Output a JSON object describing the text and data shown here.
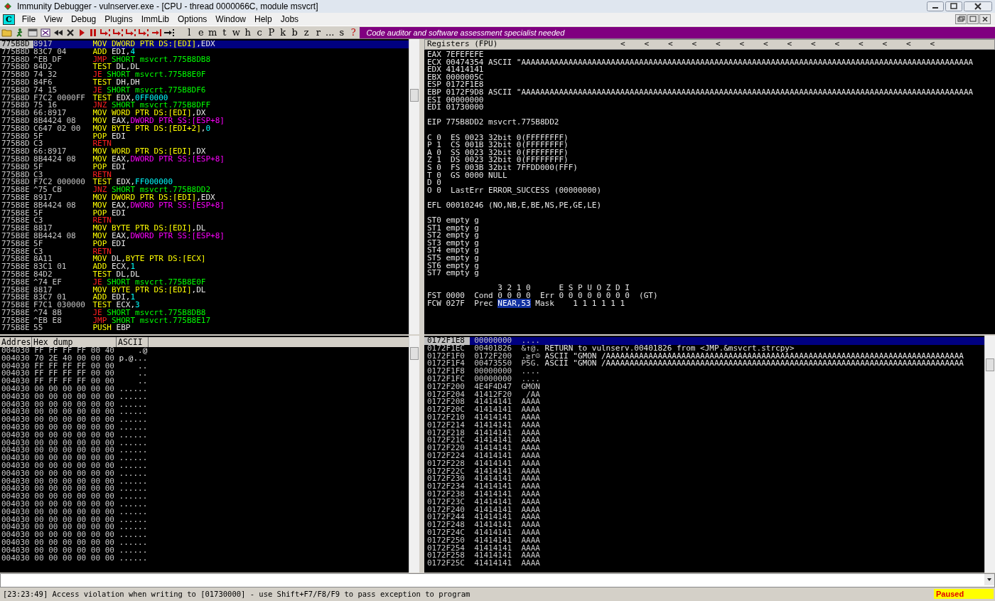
{
  "window": {
    "title": "Immunity Debugger - vulnserver.exe - [CPU - thread 0000066C, module msvcrt]"
  },
  "menu": {
    "logo": "C",
    "items": [
      "File",
      "View",
      "Debug",
      "Plugins",
      "ImmLib",
      "Options",
      "Window",
      "Help",
      "Jobs"
    ]
  },
  "toolbar": {
    "letters": [
      {
        "label": "l",
        "kind": "letter"
      },
      {
        "label": "e",
        "kind": "letter"
      },
      {
        "label": "m",
        "kind": "letter"
      },
      {
        "label": "t",
        "kind": "letter"
      },
      {
        "label": "w",
        "kind": "letter"
      },
      {
        "label": "h",
        "kind": "letter"
      },
      {
        "label": "c",
        "kind": "letter"
      },
      {
        "label": "P",
        "kind": "letter"
      },
      {
        "label": "k",
        "kind": "letter"
      },
      {
        "label": "b",
        "kind": "letter"
      },
      {
        "label": "z",
        "kind": "letter"
      },
      {
        "label": "r",
        "kind": "letter"
      },
      {
        "label": "...",
        "kind": "letter"
      },
      {
        "label": "s",
        "kind": "letter"
      },
      {
        "label": "?",
        "kind": "help"
      }
    ],
    "banner": "Code auditor and software assessment specialist needed"
  },
  "disassembly": [
    {
      "address": "775B8D",
      "bytes": "8917",
      "selected": true,
      "parts": [
        {
          "text": "MOV DWORD PTR DS:[EDI]",
          "kind": "op"
        },
        {
          "text": ",EDX",
          "kind": "reg"
        }
      ]
    },
    {
      "address": "775B8D",
      "bytes": "83C7 04",
      "selected": false,
      "parts": [
        {
          "text": "ADD",
          "kind": "op"
        },
        {
          "text": " EDI,",
          "kind": "reg"
        },
        {
          "text": "4",
          "kind": "imm"
        }
      ]
    },
    {
      "address": "775B8D",
      "bytes": "^EB DF",
      "selected": false,
      "parts": [
        {
          "text": "JMP",
          "kind": "jmp"
        },
        {
          "text": " SHORT msvcrt.775B8DB8",
          "kind": "target"
        }
      ]
    },
    {
      "address": "775B8D",
      "bytes": "84D2",
      "selected": false,
      "parts": [
        {
          "text": "TEST",
          "kind": "op"
        },
        {
          "text": " DL,DL",
          "kind": "reg"
        }
      ]
    },
    {
      "address": "775B8D",
      "bytes": "74 32",
      "selected": false,
      "parts": [
        {
          "text": "JE",
          "kind": "jmp"
        },
        {
          "text": " SHORT msvcrt.775B8E0F",
          "kind": "target"
        }
      ]
    },
    {
      "address": "775B8D",
      "bytes": "84F6",
      "selected": false,
      "parts": [
        {
          "text": "TEST",
          "kind": "op"
        },
        {
          "text": " DH,DH",
          "kind": "reg"
        }
      ]
    },
    {
      "address": "775B8D",
      "bytes": "74 15",
      "selected": false,
      "parts": [
        {
          "text": "JE",
          "kind": "jmp"
        },
        {
          "text": " SHORT msvcrt.775B8DF6",
          "kind": "target"
        }
      ]
    },
    {
      "address": "775B8D",
      "bytes": "F7C2 0000FF",
      "selected": false,
      "parts": [
        {
          "text": "TEST",
          "kind": "op"
        },
        {
          "text": " EDX,",
          "kind": "reg"
        },
        {
          "text": "0FF0000",
          "kind": "imm"
        }
      ]
    },
    {
      "address": "775B8D",
      "bytes": "75 16",
      "selected": false,
      "parts": [
        {
          "text": "JNZ",
          "kind": "jmp"
        },
        {
          "text": " SHORT msvcrt.775B8DFF",
          "kind": "target"
        }
      ]
    },
    {
      "address": "775B8D",
      "bytes": "66:8917",
      "selected": false,
      "parts": [
        {
          "text": "MOV WORD PTR DS:[EDI]",
          "kind": "op"
        },
        {
          "text": ",DX",
          "kind": "reg"
        }
      ]
    },
    {
      "address": "775B8D",
      "bytes": "8B4424 08",
      "selected": false,
      "parts": [
        {
          "text": "MOV",
          "kind": "op"
        },
        {
          "text": " EAX,",
          "kind": "reg"
        },
        {
          "text": "DWORD PTR SS:[ESP+8]",
          "kind": "stack"
        }
      ]
    },
    {
      "address": "775B8D",
      "bytes": "C647 02 00",
      "selected": false,
      "parts": [
        {
          "text": "MOV BYTE PTR DS:[EDI+2]",
          "kind": "op"
        },
        {
          "text": ",",
          "kind": "reg"
        },
        {
          "text": "0",
          "kind": "imm"
        }
      ]
    },
    {
      "address": "775B8D",
      "bytes": "5F",
      "selected": false,
      "parts": [
        {
          "text": "POP",
          "kind": "op"
        },
        {
          "text": " EDI",
          "kind": "reg"
        }
      ]
    },
    {
      "address": "775B8D",
      "bytes": "C3",
      "selected": false,
      "parts": [
        {
          "text": "RETN",
          "kind": "jmp"
        }
      ]
    },
    {
      "address": "775B8D",
      "bytes": "66:8917",
      "selected": false,
      "parts": [
        {
          "text": "MOV WORD PTR DS:[EDI]",
          "kind": "op"
        },
        {
          "text": ",DX",
          "kind": "reg"
        }
      ]
    },
    {
      "address": "775B8D",
      "bytes": "8B4424 08",
      "selected": false,
      "parts": [
        {
          "text": "MOV",
          "kind": "op"
        },
        {
          "text": " EAX,",
          "kind": "reg"
        },
        {
          "text": "DWORD PTR SS:[ESP+8]",
          "kind": "stack"
        }
      ]
    },
    {
      "address": "775B8D",
      "bytes": "5F",
      "selected": false,
      "parts": [
        {
          "text": "POP",
          "kind": "op"
        },
        {
          "text": " EDI",
          "kind": "reg"
        }
      ]
    },
    {
      "address": "775B8D",
      "bytes": "C3",
      "selected": false,
      "parts": [
        {
          "text": "RETN",
          "kind": "jmp"
        }
      ]
    },
    {
      "address": "775B8D",
      "bytes": "F7C2 000000",
      "selected": false,
      "parts": [
        {
          "text": "TEST",
          "kind": "op"
        },
        {
          "text": " EDX,",
          "kind": "reg"
        },
        {
          "text": "FF000000",
          "kind": "imm"
        }
      ]
    },
    {
      "address": "775B8E",
      "bytes": "^75 CB",
      "selected": false,
      "parts": [
        {
          "text": "JNZ",
          "kind": "jmp"
        },
        {
          "text": " SHORT msvcrt.775B8DD2",
          "kind": "target"
        }
      ]
    },
    {
      "address": "775B8E",
      "bytes": "8917",
      "selected": false,
      "parts": [
        {
          "text": "MOV DWORD PTR DS:[EDI]",
          "kind": "op"
        },
        {
          "text": ",EDX",
          "kind": "reg"
        }
      ]
    },
    {
      "address": "775B8E",
      "bytes": "8B4424 08",
      "selected": false,
      "parts": [
        {
          "text": "MOV",
          "kind": "op"
        },
        {
          "text": " EAX,",
          "kind": "reg"
        },
        {
          "text": "DWORD PTR SS:[ESP+8]",
          "kind": "stack"
        }
      ]
    },
    {
      "address": "775B8E",
      "bytes": "5F",
      "selected": false,
      "parts": [
        {
          "text": "POP",
          "kind": "op"
        },
        {
          "text": " EDI",
          "kind": "reg"
        }
      ]
    },
    {
      "address": "775B8E",
      "bytes": "C3",
      "selected": false,
      "parts": [
        {
          "text": "RETN",
          "kind": "jmp"
        }
      ]
    },
    {
      "address": "775B8E",
      "bytes": "8817",
      "selected": false,
      "parts": [
        {
          "text": "MOV BYTE PTR DS:[EDI]",
          "kind": "op"
        },
        {
          "text": ",DL",
          "kind": "reg"
        }
      ]
    },
    {
      "address": "775B8E",
      "bytes": "8B4424 08",
      "selected": false,
      "parts": [
        {
          "text": "MOV",
          "kind": "op"
        },
        {
          "text": " EAX,",
          "kind": "reg"
        },
        {
          "text": "DWORD PTR SS:[ESP+8]",
          "kind": "stack"
        }
      ]
    },
    {
      "address": "775B8E",
      "bytes": "5F",
      "selected": false,
      "parts": [
        {
          "text": "POP",
          "kind": "op"
        },
        {
          "text": " EDI",
          "kind": "reg"
        }
      ]
    },
    {
      "address": "775B8E",
      "bytes": "C3",
      "selected": false,
      "parts": [
        {
          "text": "RETN",
          "kind": "jmp"
        }
      ]
    },
    {
      "address": "775B8E",
      "bytes": "8A11",
      "selected": false,
      "parts": [
        {
          "text": "MOV",
          "kind": "op"
        },
        {
          "text": " DL,",
          "kind": "reg"
        },
        {
          "text": "BYTE PTR DS:[ECX]",
          "kind": "op"
        }
      ]
    },
    {
      "address": "775B8E",
      "bytes": "83C1 01",
      "selected": false,
      "parts": [
        {
          "text": "ADD",
          "kind": "op"
        },
        {
          "text": " ECX,",
          "kind": "reg"
        },
        {
          "text": "1",
          "kind": "imm"
        }
      ]
    },
    {
      "address": "775B8E",
      "bytes": "84D2",
      "selected": false,
      "parts": [
        {
          "text": "TEST",
          "kind": "op"
        },
        {
          "text": " DL,DL",
          "kind": "reg"
        }
      ]
    },
    {
      "address": "775B8E",
      "bytes": "^74 EF",
      "selected": false,
      "parts": [
        {
          "text": "JE",
          "kind": "jmp"
        },
        {
          "text": " SHORT msvcrt.775B8E0F",
          "kind": "target"
        }
      ]
    },
    {
      "address": "775B8E",
      "bytes": "8817",
      "selected": false,
      "parts": [
        {
          "text": "MOV BYTE PTR DS:[EDI]",
          "kind": "op"
        },
        {
          "text": ",DL",
          "kind": "reg"
        }
      ]
    },
    {
      "address": "775B8E",
      "bytes": "83C7 01",
      "selected": false,
      "parts": [
        {
          "text": "ADD",
          "kind": "op"
        },
        {
          "text": " EDI,",
          "kind": "reg"
        },
        {
          "text": "1",
          "kind": "imm"
        }
      ]
    },
    {
      "address": "775B8E",
      "bytes": "F7C1 030000",
      "selected": false,
      "parts": [
        {
          "text": "TEST",
          "kind": "op"
        },
        {
          "text": " ECX,",
          "kind": "reg"
        },
        {
          "text": "3",
          "kind": "imm"
        }
      ]
    },
    {
      "address": "775B8E",
      "bytes": "^74 8B",
      "selected": false,
      "parts": [
        {
          "text": "JE",
          "kind": "jmp"
        },
        {
          "text": " SHORT msvcrt.775B8DB8",
          "kind": "target"
        }
      ]
    },
    {
      "address": "775B8E",
      "bytes": "^EB E8",
      "selected": false,
      "parts": [
        {
          "text": "JMP",
          "kind": "jmp"
        },
        {
          "text": " SHORT msvcrt.775B8E17",
          "kind": "target"
        }
      ]
    },
    {
      "address": "775B8E",
      "bytes": "55",
      "selected": false,
      "parts": [
        {
          "text": "PUSH",
          "kind": "op"
        },
        {
          "text": " EBP",
          "kind": "reg"
        }
      ]
    }
  ],
  "registers": {
    "title": "Registers (FPU)",
    "arrows": [
      "<",
      "<",
      "<",
      "<",
      "<",
      "<",
      "<",
      "<",
      "<",
      "<",
      "<",
      "<",
      "<",
      "<"
    ],
    "groups": [
      [
        "EAX 7EFEFEFE",
        "ECX 00474354 ASCII \"AAAAAAAAAAAAAAAAAAAAAAAAAAAAAAAAAAAAAAAAAAAAAAAAAAAAAAAAAAAAAAAAAAAAAAAAAAAAAAAAAAAAAAAAAAAAAAAA",
        "EDX 41414141",
        "EBX 0000005C",
        "ESP 0172F1E8",
        "EBP 0172F9D8 ASCII \"AAAAAAAAAAAAAAAAAAAAAAAAAAAAAAAAAAAAAAAAAAAAAAAAAAAAAAAAAAAAAAAAAAAAAAAAAAAAAAAAAAAAAAAAAAAAAAAA",
        "ESI 00000000",
        "EDI 01730000"
      ],
      [
        "EIP 775B8DD2 msvcrt.775B8DD2"
      ],
      [
        "C 0  ES 0023 32bit 0(FFFFFFFF)",
        "P 1  CS 001B 32bit 0(FFFFFFFF)",
        "A 0  SS 0023 32bit 0(FFFFFFFF)",
        "Z 1  DS 0023 32bit 0(FFFFFFFF)",
        "S 0  FS 003B 32bit 7FFDD000(FFF)",
        "T 0  GS 0000 NULL",
        "D 0",
        "O 0  LastErr ERROR_SUCCESS (00000000)"
      ],
      [
        "EFL 00010246 (NO,NB,E,BE,NS,PE,GE,LE)"
      ],
      [
        "ST0 empty g",
        "ST1 empty g",
        "ST2 empty g",
        "ST3 empty g",
        "ST4 empty g",
        "ST5 empty g",
        "ST6 empty g",
        "ST7 empty g"
      ]
    ],
    "fpu": {
      "cond_bits": "3 2 1 0",
      "err_bits": "E S P U O Z D I",
      "status_line": "FST 0000  Cond 0 0 0 0  Err 0 0 0 0 0 0 0 0  (GT)",
      "control_label": "FCW 027F  Prec",
      "precision": "NEAR,53",
      "mask": "Mask    1 1 1 1 1 1"
    }
  },
  "dump": {
    "columns": [
      "Addres",
      "Hex dump",
      "ASCII"
    ],
    "rows": [
      {
        "address": "004030",
        "hex": "FF FF FF FF 00 40",
        "ascii": ".@"
      },
      {
        "address": "004030",
        "hex": "70 2E 40 00 00 00",
        "ascii": "p.@..."
      },
      {
        "address": "004030",
        "hex": "FF FF FF FF 00 00",
        "ascii": ".."
      },
      {
        "address": "004030",
        "hex": "FF FF FF FF 00 00",
        "ascii": ".."
      },
      {
        "address": "004030",
        "hex": "FF FF FF FF 00 00",
        "ascii": ".."
      },
      {
        "address": "004030",
        "hex": "00 00 00 00 00 00",
        "ascii": "......"
      },
      {
        "address": "004030",
        "hex": "00 00 00 00 00 00",
        "ascii": "......"
      },
      {
        "address": "004030",
        "hex": "00 00 00 00 00 00",
        "ascii": "......"
      },
      {
        "address": "004030",
        "hex": "00 00 00 00 00 00",
        "ascii": "......"
      },
      {
        "address": "004030",
        "hex": "00 00 00 00 00 00",
        "ascii": "......"
      },
      {
        "address": "004030",
        "hex": "00 00 00 00 00 00",
        "ascii": "......"
      },
      {
        "address": "004030",
        "hex": "00 00 00 00 00 00",
        "ascii": "......"
      },
      {
        "address": "004030",
        "hex": "00 00 00 00 00 00",
        "ascii": "......"
      },
      {
        "address": "004030",
        "hex": "00 00 00 00 00 00",
        "ascii": "......"
      },
      {
        "address": "004030",
        "hex": "00 00 00 00 00 00",
        "ascii": "......"
      },
      {
        "address": "004030",
        "hex": "00 00 00 00 00 00",
        "ascii": "......"
      },
      {
        "address": "004030",
        "hex": "00 00 00 00 00 00",
        "ascii": "......"
      },
      {
        "address": "004030",
        "hex": "00 00 00 00 00 00",
        "ascii": "......"
      },
      {
        "address": "004030",
        "hex": "00 00 00 00 00 00",
        "ascii": "......"
      },
      {
        "address": "004030",
        "hex": "00 00 00 00 00 00",
        "ascii": "......"
      },
      {
        "address": "004030",
        "hex": "00 00 00 00 00 00",
        "ascii": "......"
      },
      {
        "address": "004030",
        "hex": "00 00 00 00 00 00",
        "ascii": "......"
      },
      {
        "address": "004030",
        "hex": "00 00 00 00 00 00",
        "ascii": "......"
      },
      {
        "address": "004030",
        "hex": "00 00 00 00 00 00",
        "ascii": "......"
      },
      {
        "address": "004030",
        "hex": "00 00 00 00 00 00",
        "ascii": "......"
      },
      {
        "address": "004030",
        "hex": "00 00 00 00 00 00",
        "ascii": "......"
      },
      {
        "address": "004030",
        "hex": "00 00 00 00 00 00",
        "ascii": "......"
      },
      {
        "address": "004030",
        "hex": "00 00 00 00 00 00",
        "ascii": "......"
      }
    ]
  },
  "stack": [
    {
      "address": "0172F1E8",
      "value": "00000000",
      "ascii": "....",
      "selected": true
    },
    {
      "address": "0172F1EC",
      "value": "00401826",
      "ascii": "&↑@.",
      "comment": "RETURN to vulnserv.00401826 from <JMP.&msvcrt.strcpy>",
      "selected": false
    },
    {
      "address": "0172F1F0",
      "value": "0172F200",
      "ascii": ".≥r☺",
      "comment": "ASCII \"GMON /AAAAAAAAAAAAAAAAAAAAAAAAAAAAAAAAAAAAAAAAAAAAAAAAAAAAAAAAAAAAAAAAAAAAAAAAAAAA",
      "selected": false
    },
    {
      "address": "0172F1F4",
      "value": "00473550",
      "ascii": "P5G.",
      "comment": "ASCII \"GMON /AAAAAAAAAAAAAAAAAAAAAAAAAAAAAAAAAAAAAAAAAAAAAAAAAAAAAAAAAAAAAAAAAAAAAAAAAAAA",
      "selected": false
    },
    {
      "address": "0172F1F8",
      "value": "00000000",
      "ascii": "....",
      "selected": false
    },
    {
      "address": "0172F1FC",
      "value": "00000000",
      "ascii": "....",
      "selected": false
    },
    {
      "address": "0172F200",
      "value": "4E4F4D47",
      "ascii": "GMON",
      "selected": false
    },
    {
      "address": "0172F204",
      "value": "41412F20",
      "ascii": " /AA",
      "selected": false
    },
    {
      "address": "0172F208",
      "value": "41414141",
      "ascii": "AAAA",
      "selected": false
    },
    {
      "address": "0172F20C",
      "value": "41414141",
      "ascii": "AAAA",
      "selected": false
    },
    {
      "address": "0172F210",
      "value": "41414141",
      "ascii": "AAAA",
      "selected": false
    },
    {
      "address": "0172F214",
      "value": "41414141",
      "ascii": "AAAA",
      "selected": false
    },
    {
      "address": "0172F218",
      "value": "41414141",
      "ascii": "AAAA",
      "selected": false
    },
    {
      "address": "0172F21C",
      "value": "41414141",
      "ascii": "AAAA",
      "selected": false
    },
    {
      "address": "0172F220",
      "value": "41414141",
      "ascii": "AAAA",
      "selected": false
    },
    {
      "address": "0172F224",
      "value": "41414141",
      "ascii": "AAAA",
      "selected": false
    },
    {
      "address": "0172F228",
      "value": "41414141",
      "ascii": "AAAA",
      "selected": false
    },
    {
      "address": "0172F22C",
      "value": "41414141",
      "ascii": "AAAA",
      "selected": false
    },
    {
      "address": "0172F230",
      "value": "41414141",
      "ascii": "AAAA",
      "selected": false
    },
    {
      "address": "0172F234",
      "value": "41414141",
      "ascii": "AAAA",
      "selected": false
    },
    {
      "address": "0172F238",
      "value": "41414141",
      "ascii": "AAAA",
      "selected": false
    },
    {
      "address": "0172F23C",
      "value": "41414141",
      "ascii": "AAAA",
      "selected": false
    },
    {
      "address": "0172F240",
      "value": "41414141",
      "ascii": "AAAA",
      "selected": false
    },
    {
      "address": "0172F244",
      "value": "41414141",
      "ascii": "AAAA",
      "selected": false
    },
    {
      "address": "0172F248",
      "value": "41414141",
      "ascii": "AAAA",
      "selected": false
    },
    {
      "address": "0172F24C",
      "value": "41414141",
      "ascii": "AAAA",
      "selected": false
    },
    {
      "address": "0172F250",
      "value": "41414141",
      "ascii": "AAAA",
      "selected": false
    },
    {
      "address": "0172F254",
      "value": "41414141",
      "ascii": "AAAA",
      "selected": false
    },
    {
      "address": "0172F258",
      "value": "41414141",
      "ascii": "AAAA",
      "selected": false
    },
    {
      "address": "0172F25C",
      "value": "41414141",
      "ascii": "AAAA",
      "selected": false
    }
  ],
  "status_bar": {
    "message": "[23:23:49] Access violation when writing to [01730000] - use Shift+F7/F8/F9 to pass exception to program",
    "state": "Paused"
  }
}
